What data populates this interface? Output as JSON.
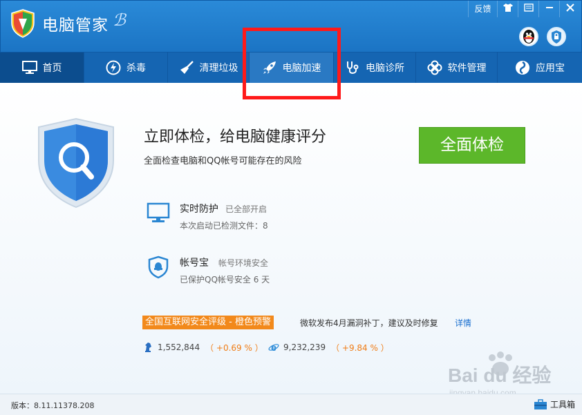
{
  "app": {
    "title": "电脑管家"
  },
  "window_controls": {
    "feedback": "反馈",
    "skin_icon": "shirt-icon",
    "menu_icon": "menu-icon",
    "min_icon": "minimize-icon",
    "close_icon": "close-icon"
  },
  "nav": {
    "items": [
      {
        "label": "首页",
        "icon": "monitor-icon",
        "state": "active"
      },
      {
        "label": "杀毒",
        "icon": "lightning-icon",
        "state": "normal"
      },
      {
        "label": "清理垃圾",
        "icon": "broom-icon",
        "state": "normal"
      },
      {
        "label": "电脑加速",
        "icon": "rocket-icon",
        "state": "hover"
      },
      {
        "label": "电脑诊所",
        "icon": "stethoscope-icon",
        "state": "normal"
      },
      {
        "label": "软件管理",
        "icon": "clover-icon",
        "state": "normal"
      },
      {
        "label": "应用宝",
        "icon": "app-store-icon",
        "state": "normal"
      }
    ]
  },
  "main": {
    "headline": "立即体检，给电脑健康评分",
    "subline": "全面检查电脑和QQ帐号可能存在的风险",
    "scan_button": "全面体检",
    "status": [
      {
        "title": "实时防护",
        "state": "已全部开启",
        "detail": "本次启动已检测文件：8",
        "icon": "monitor-icon"
      },
      {
        "title": "帐号宝",
        "state": "帐号环境安全",
        "detail": "已保护QQ帐号安全 6 天",
        "icon": "qq-shield-icon"
      }
    ],
    "alert": {
      "badge": "全国互联网安全评级 - 橙色预警",
      "text": "微软发布4月漏洞补丁，建议及时修复",
      "link": "详情"
    },
    "stats": [
      {
        "icon": "chess-knight-icon",
        "value": "1,552,844",
        "pct": "（ +0.69 % ）"
      },
      {
        "icon": "ie-icon",
        "value": "9,232,239",
        "pct": "（ +9.84 % ）"
      }
    ]
  },
  "footer": {
    "version": "版本：8.11.11378.208",
    "toolbox": "工具箱"
  },
  "watermark": {
    "brand": "Bai du 经验",
    "site": "jingyan.baidu.com"
  },
  "colors": {
    "title_bar": "#1f7fcf",
    "nav_bar": "#1565b2",
    "scan_button": "#5cb72a",
    "alert_badge": "#f2891b",
    "highlight": "#ff1a1a"
  }
}
